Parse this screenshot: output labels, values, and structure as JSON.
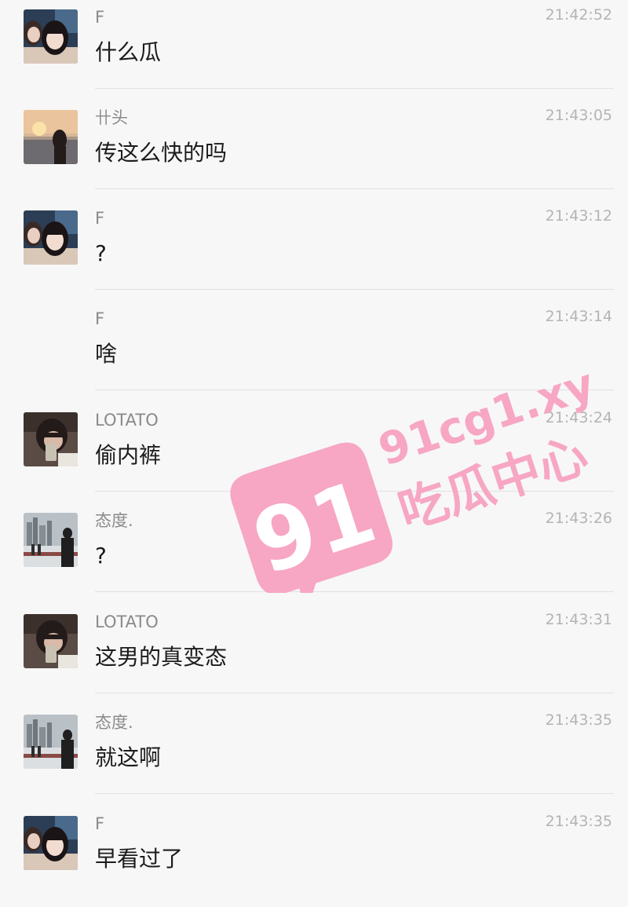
{
  "messages": [
    {
      "sender": "F",
      "time": "21:42:52",
      "text": "什么瓜",
      "avatar": "avatar-girl-selfie"
    },
    {
      "sender": "卄头",
      "time": "21:43:05",
      "text": "传这么快的吗",
      "avatar": "avatar-sunset"
    },
    {
      "sender": "F",
      "time": "21:43:12",
      "text": "?",
      "avatar": "avatar-girl-selfie"
    },
    {
      "sender": "F",
      "time": "21:43:14",
      "text": "啥",
      "avatar": ""
    },
    {
      "sender": "LOTATO",
      "time": "21:43:24",
      "text": "偷内裤",
      "avatar": "avatar-phone-selfie"
    },
    {
      "sender": "态度.",
      "time": "21:43:26",
      "text": "?",
      "avatar": "avatar-city-skyline"
    },
    {
      "sender": "LOTATO",
      "time": "21:43:31",
      "text": "这男的真变态",
      "avatar": "avatar-phone-selfie"
    },
    {
      "sender": "态度.",
      "time": "21:43:35",
      "text": "就这啊",
      "avatar": "avatar-city-skyline"
    },
    {
      "sender": "F",
      "time": "21:43:35",
      "text": "早看过了",
      "avatar": "avatar-girl-selfie"
    }
  ],
  "watermark": {
    "badge_text": "91",
    "site": "91cg1.xyz",
    "brand": "吃瓜中心",
    "color": "#f7a6c4"
  }
}
